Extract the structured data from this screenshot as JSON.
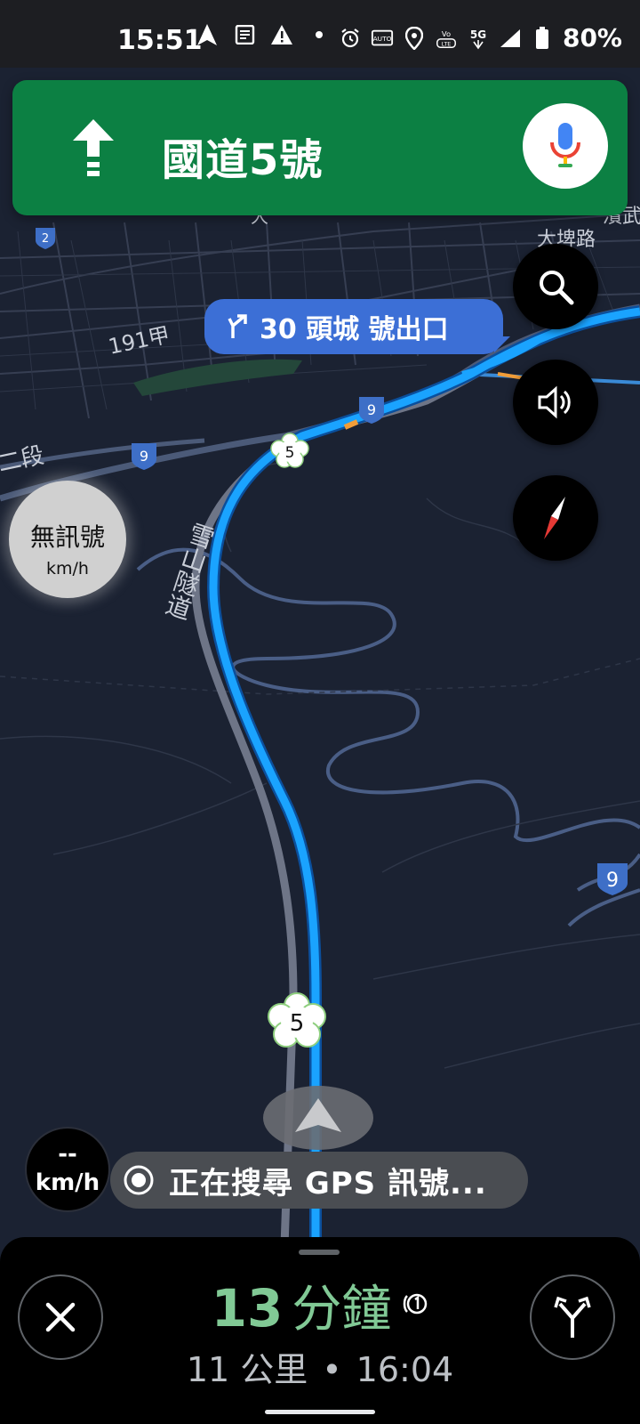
{
  "status_bar": {
    "time": "15:51",
    "battery": "80%",
    "network": "5G",
    "volte": "Vo LTE",
    "auto": "AUTO"
  },
  "navigation": {
    "street": "國道5號",
    "direction": "straight",
    "exit_label": "30 頭城 號出口"
  },
  "map_labels": {
    "tunnel": "雪山隧道",
    "road_191": "191甲",
    "area_daping": "大埤路",
    "area_partial_right": "濱武",
    "area_partial_left": "二段",
    "top_partial": "大",
    "shield_9": "9",
    "shield_2": "2",
    "shield_5": "5"
  },
  "speed_limit": {
    "text": "無訊號",
    "unit": "km/h"
  },
  "speedometer": {
    "value": "--",
    "unit": "km/h"
  },
  "gps_toast": {
    "text": "正在搜尋 GPS 訊號..."
  },
  "trip": {
    "minutes": "13",
    "minutes_unit": "分鐘",
    "distance": "11 公里",
    "separator": "•",
    "arrival": "16:04"
  },
  "colors": {
    "banner_green": "#0c8043",
    "route_blue": "#1aa3ff",
    "eta_green": "#81c995",
    "map_bg": "#1b2232",
    "exit_blue": "#3c6fd6"
  },
  "icons": {
    "nav_arrow": "straight-arrow-icon",
    "mic": "mic-icon",
    "search": "search-icon",
    "sound": "volume-icon",
    "compass": "compass-icon",
    "close": "close-icon",
    "route_options": "fork-route-icon",
    "gps": "gps-target-icon"
  }
}
